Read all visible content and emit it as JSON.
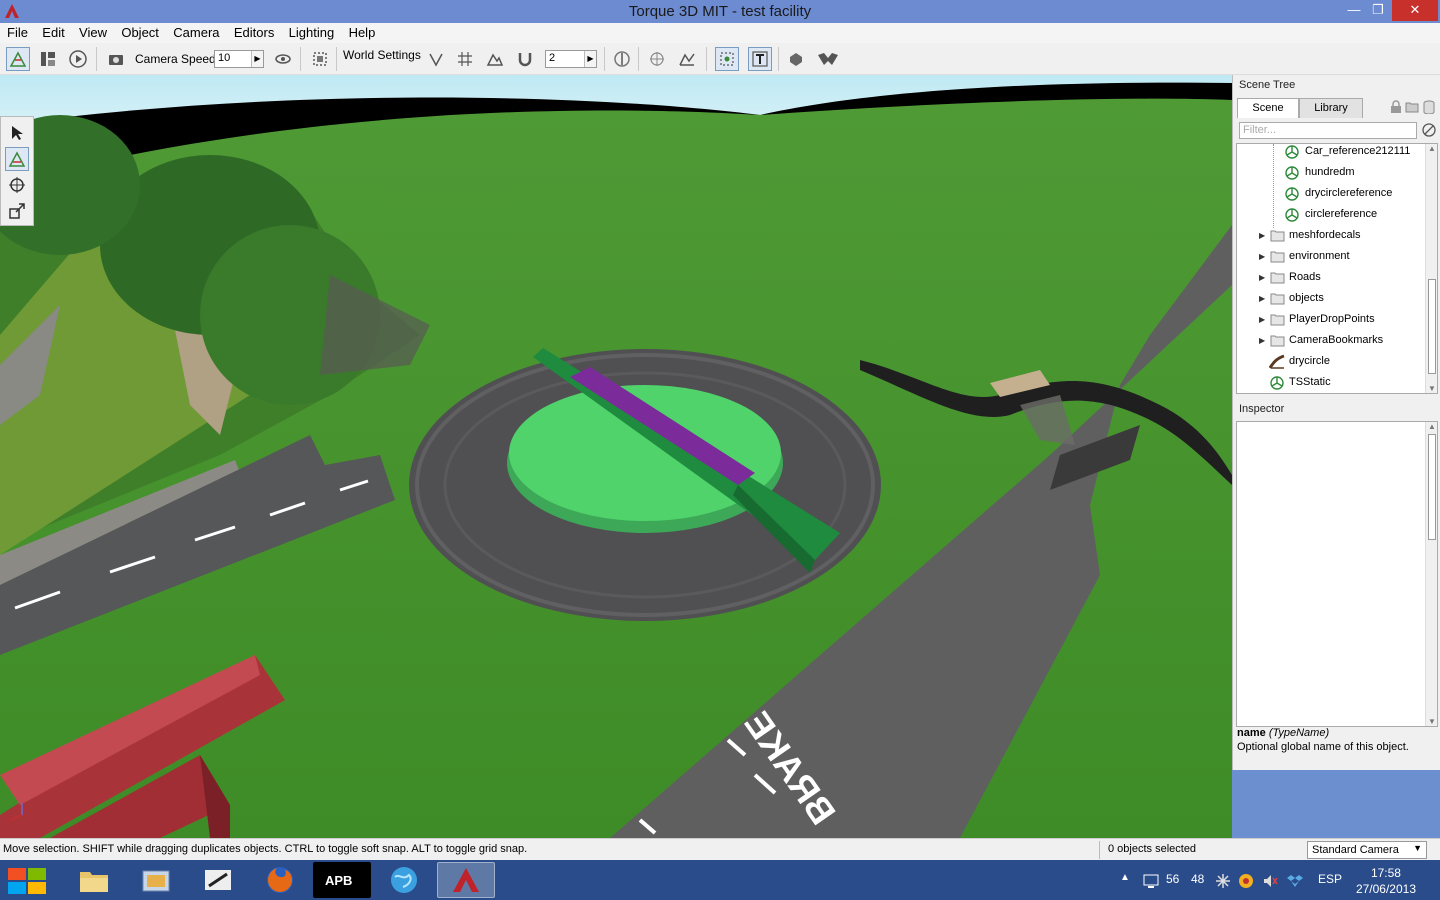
{
  "window": {
    "title": "Torque 3D MIT - test facility",
    "minimize_glyph": "—",
    "restore_glyph": "❐",
    "close_glyph": "✕"
  },
  "menu": [
    "File",
    "Edit",
    "View",
    "Object",
    "Camera",
    "Editors",
    "Lighting",
    "Help"
  ],
  "toolbar": {
    "camera_speed_label": "Camera Speed",
    "camera_speed_value": "10",
    "world_settings_label": "World Settings",
    "grid_value": "2"
  },
  "viewport": {
    "road_marking_text": "BRAKE"
  },
  "scene_tree": {
    "header": "Scene Tree",
    "tabs": [
      "Scene",
      "Library"
    ],
    "filter_placeholder": "Filter...",
    "items": [
      {
        "label": "Car_reference212111",
        "icon": "shape-icon",
        "indent": 2,
        "expander": ""
      },
      {
        "label": "hundredm",
        "icon": "shape-icon",
        "indent": 2,
        "expander": ""
      },
      {
        "label": "drycirclereference",
        "icon": "shape-icon",
        "indent": 2,
        "expander": ""
      },
      {
        "label": "circlereference",
        "icon": "shape-icon",
        "indent": 2,
        "expander": ""
      },
      {
        "label": "meshfordecals",
        "icon": "folder-icon",
        "indent": 1,
        "expander": "▶"
      },
      {
        "label": "environment",
        "icon": "folder-icon",
        "indent": 1,
        "expander": "▶"
      },
      {
        "label": "Roads",
        "icon": "folder-icon",
        "indent": 1,
        "expander": "▶"
      },
      {
        "label": "objects",
        "icon": "folder-icon",
        "indent": 1,
        "expander": "▶"
      },
      {
        "label": "PlayerDropPoints",
        "icon": "folder-icon",
        "indent": 1,
        "expander": "▶"
      },
      {
        "label": "CameraBookmarks",
        "icon": "folder-icon",
        "indent": 1,
        "expander": "▶"
      },
      {
        "label": "drycircle",
        "icon": "road-icon",
        "indent": 1,
        "expander": ""
      },
      {
        "label": "TSStatic",
        "icon": "shape-icon",
        "indent": 1,
        "expander": ""
      }
    ]
  },
  "inspector": {
    "header": "Inspector",
    "field_name": "name",
    "field_type": "(TypeName)",
    "field_desc": "Optional global name of this object."
  },
  "status": {
    "message": "Move selection.  SHIFT while dragging duplicates objects.  CTRL to toggle soft snap.  ALT to toggle grid snap.",
    "selection": "0 objects selected",
    "camera_mode": "Standard Camera"
  },
  "taskbar": {
    "tray_num1": "56",
    "tray_num2": "48",
    "language": "ESP",
    "time": "17:58",
    "date": "27/06/2013"
  },
  "colors": {
    "title_bar": "#6c8bd1",
    "taskbar": "#2a4c8a",
    "grass": "#4c9a2c",
    "asphalt": "#5f5f60",
    "disc_green": "#4fd36a",
    "bar_purple": "#7b2c9a",
    "block_red": "#a8343a"
  }
}
